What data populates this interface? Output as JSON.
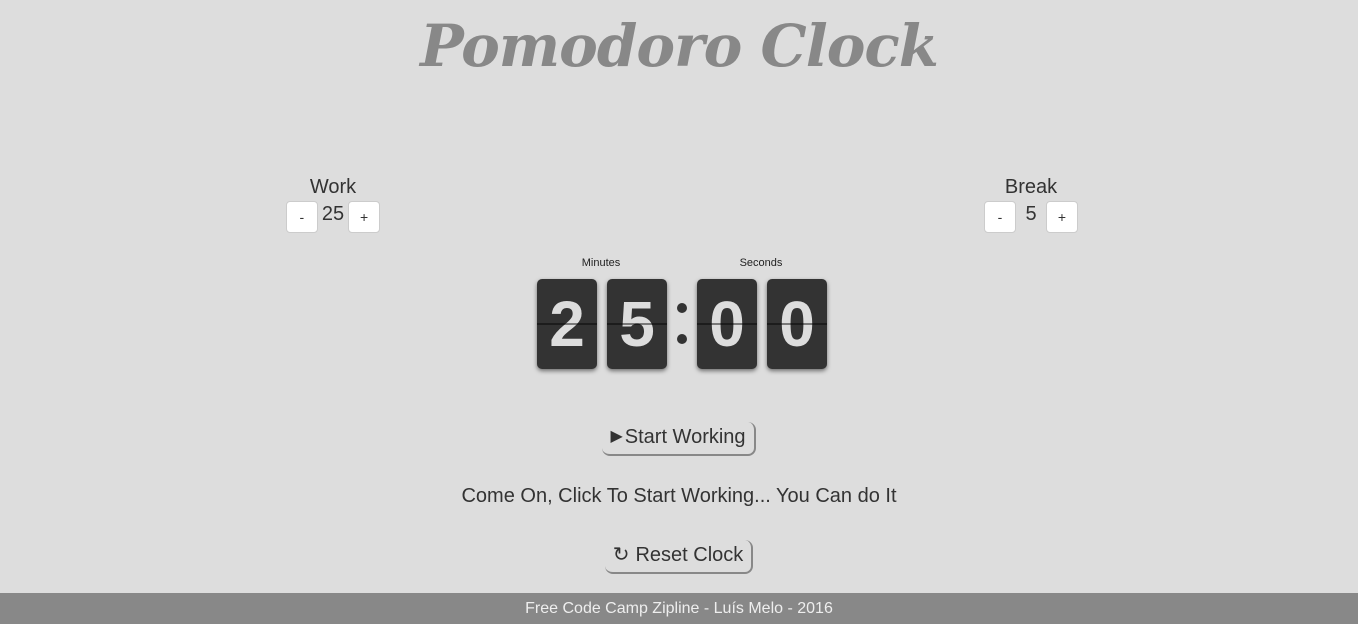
{
  "title": "Pomodoro Clock",
  "work": {
    "label": "Work",
    "decrement_label": "-",
    "value": "25",
    "increment_label": "+"
  },
  "break": {
    "label": "Break",
    "decrement_label": "-",
    "value": "5",
    "increment_label": "+"
  },
  "clock": {
    "minutes_label": "Minutes",
    "seconds_label": "Seconds",
    "digits": [
      "2",
      "5",
      "0",
      "0"
    ]
  },
  "start_button": {
    "icon": "play-icon",
    "icon_glyph": "▶",
    "label": "Start Working"
  },
  "message": "Come On, Click To Start Working... You Can do It",
  "reset_button": {
    "icon": "refresh-icon",
    "icon_glyph": "↻",
    "label": "Reset Clock"
  },
  "footer": "Free Code Camp Zipline - Luís Melo - 2016",
  "colors": {
    "background": "#dddddd",
    "title": "#888888",
    "digit_bg": "#333333",
    "digit_text": "#dddddd",
    "footer_bg": "#888888"
  }
}
